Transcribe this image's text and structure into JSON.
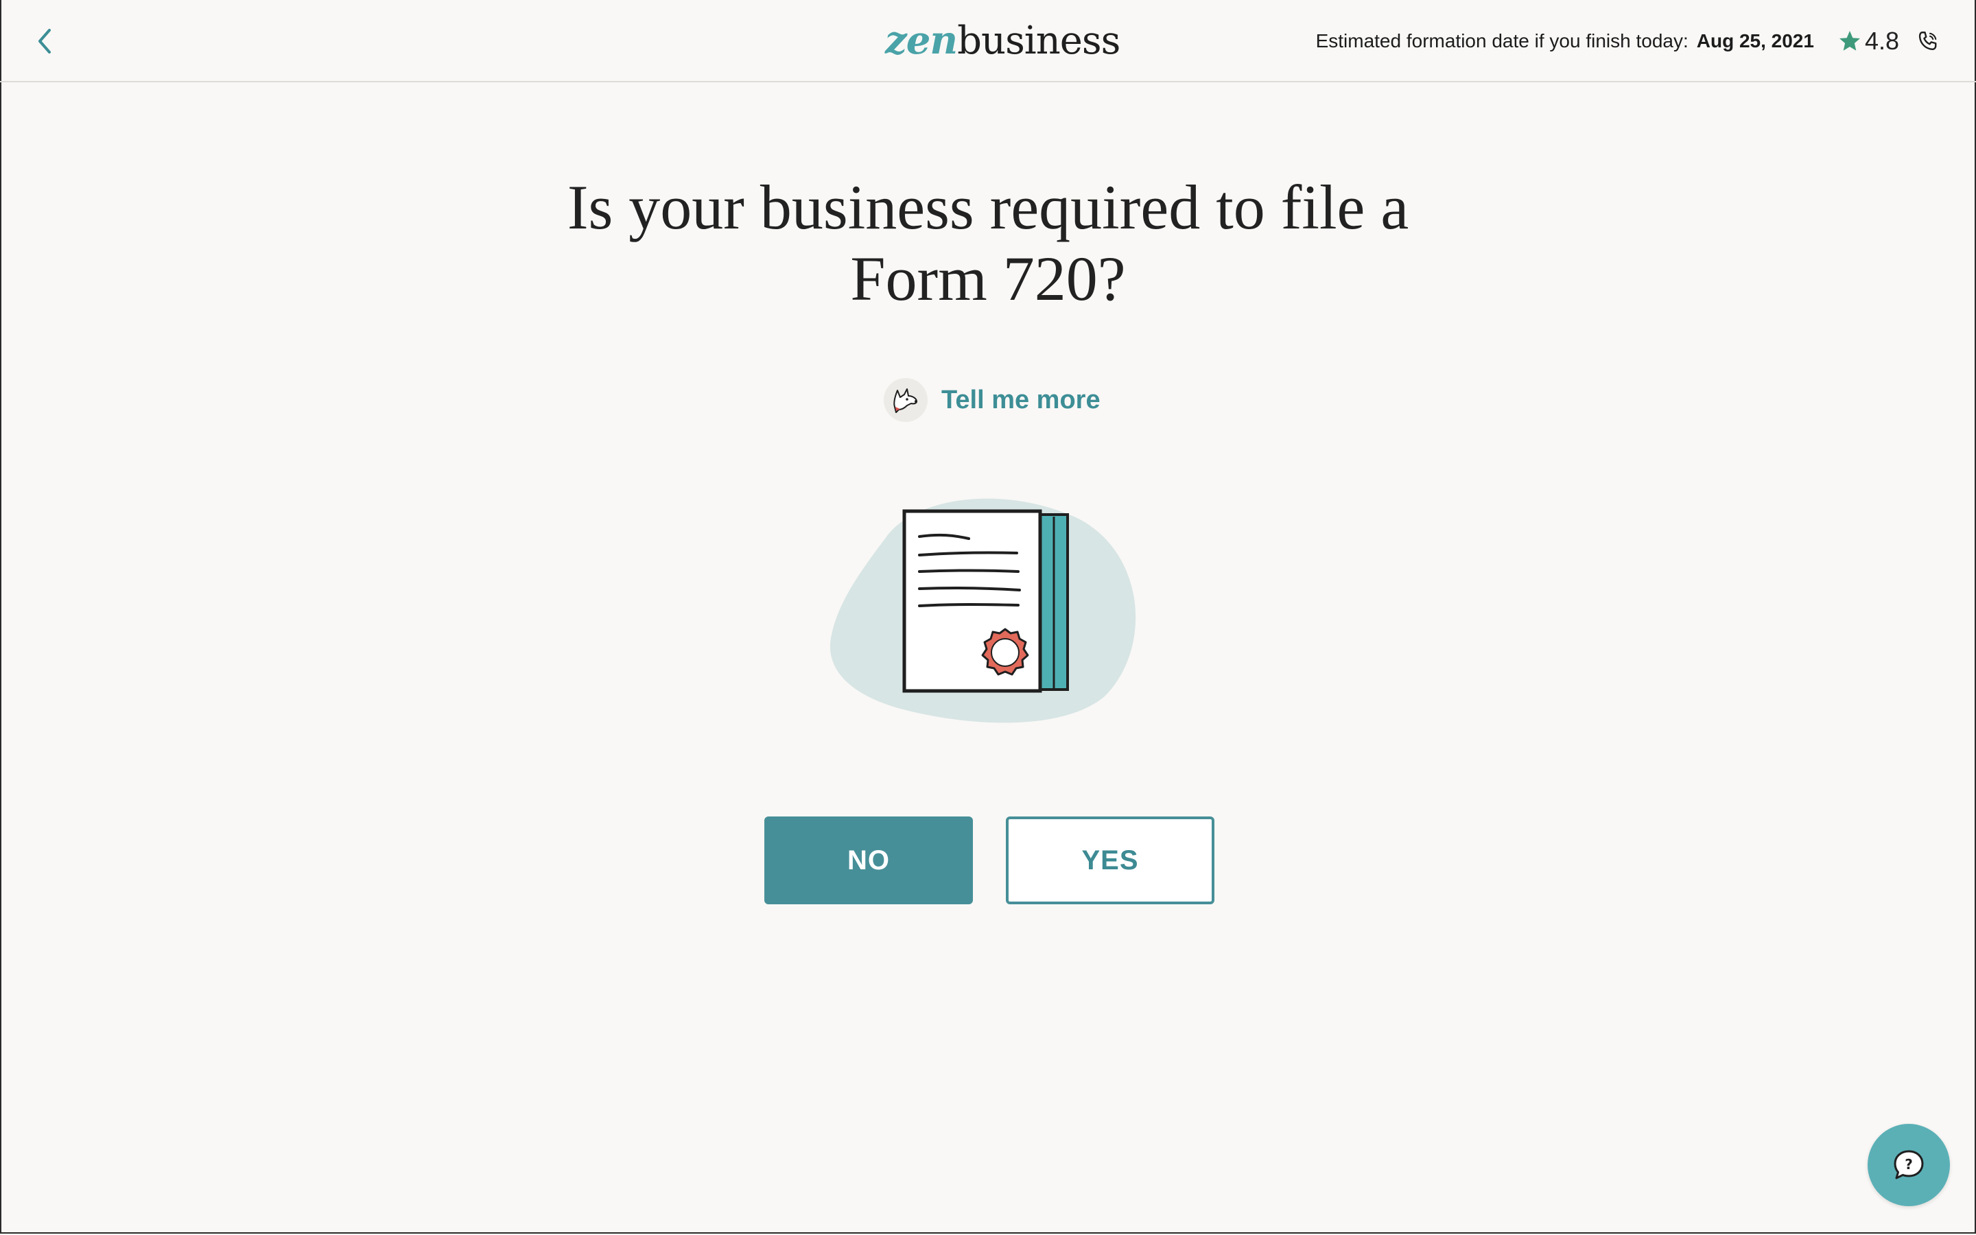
{
  "header": {
    "back_icon": "chevron-left-icon",
    "logo": {
      "part1": "zen",
      "part2": "business"
    },
    "estimate_label": "Estimated formation date if you finish today:",
    "estimate_date": "Aug 25, 2021",
    "rating_icon": "star-icon",
    "rating": "4.8",
    "phone_icon": "phone-icon"
  },
  "main": {
    "question_line1": "Is your business required to file a",
    "question_line2": "Form 720?",
    "tell_more_label": "Tell me more",
    "illustration_icon": "document-seal-icon",
    "no_label": "NO",
    "yes_label": "YES"
  },
  "help": {
    "icon": "chat-question-icon"
  },
  "colors": {
    "accent": "#478f98",
    "logo_teal": "#4aa3a8",
    "link": "#3d8e96",
    "star": "#3f9a7c",
    "background": "#f9f8f6",
    "fab": "#5bb0b6"
  }
}
